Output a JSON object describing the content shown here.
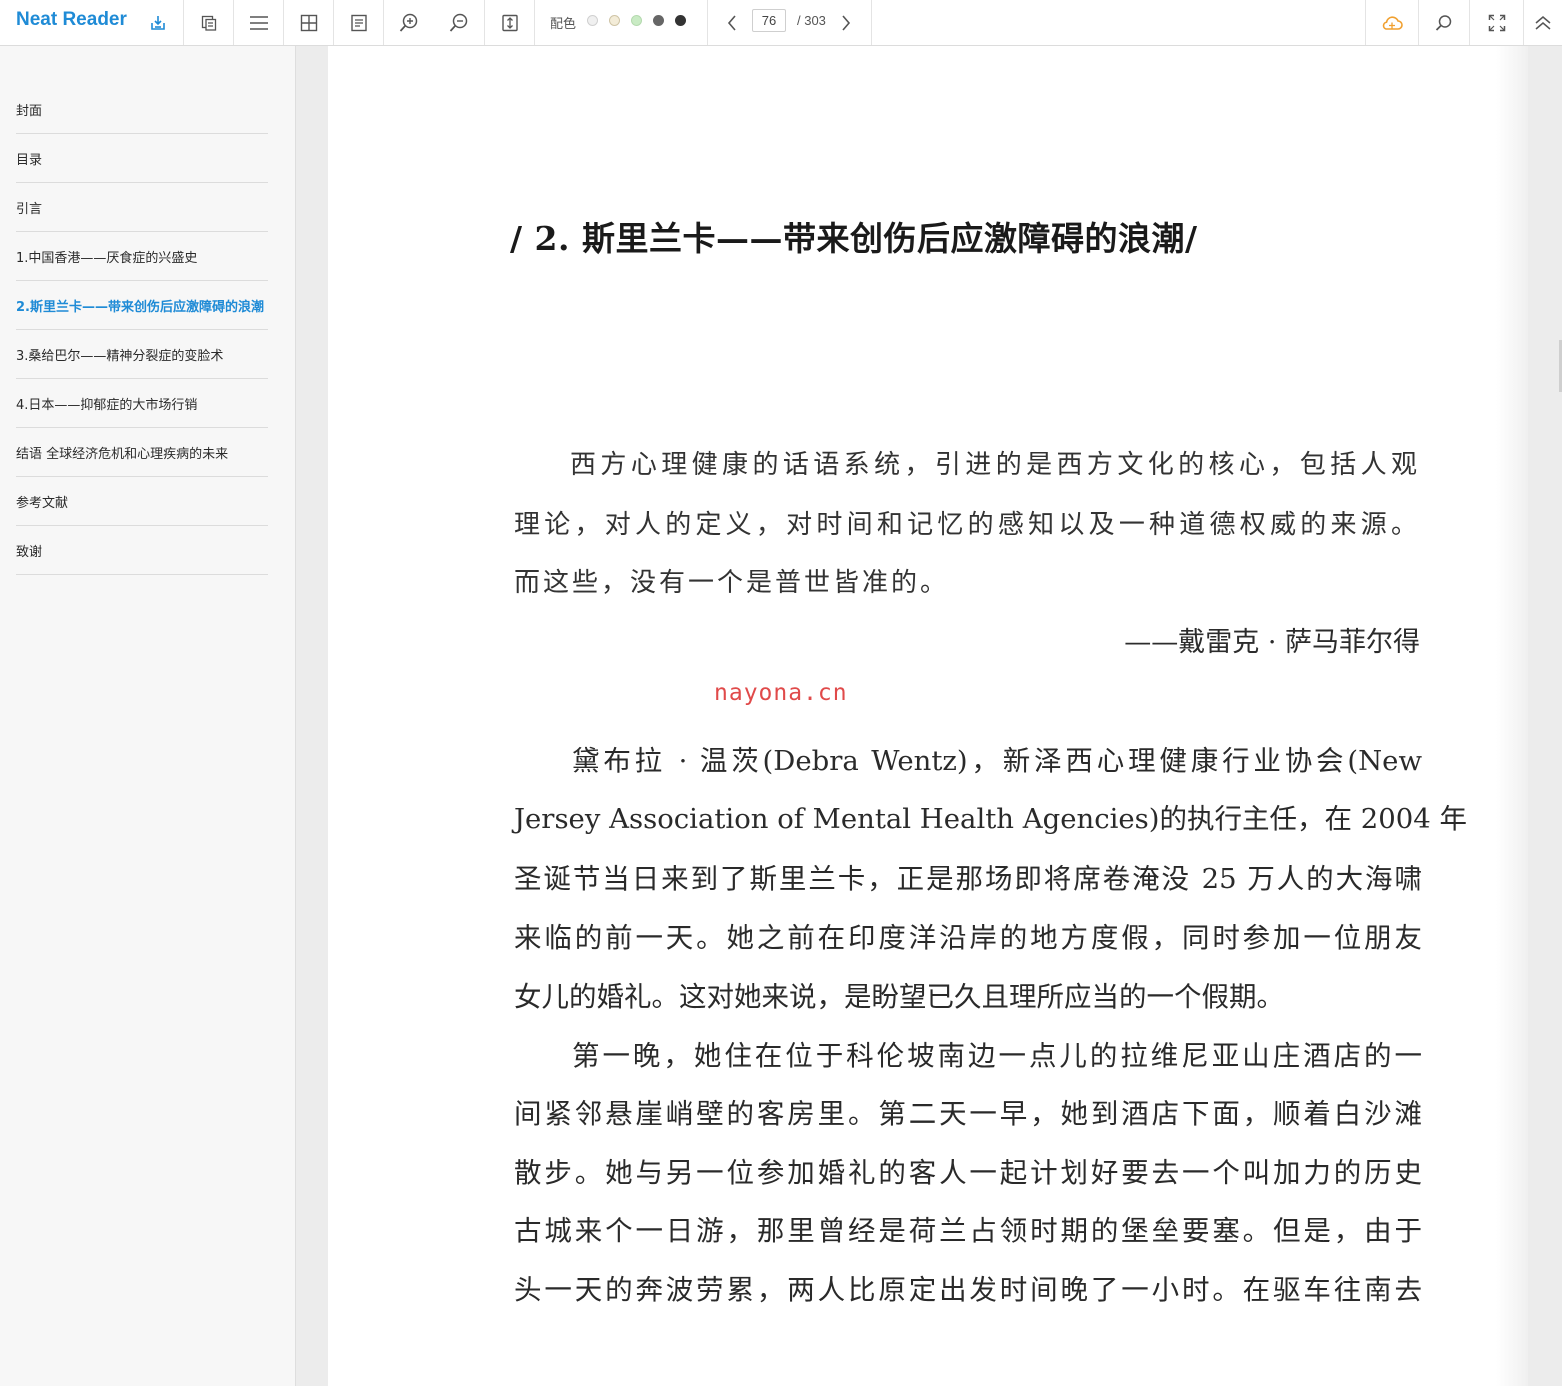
{
  "app": {
    "title": "Neat Reader"
  },
  "toolbar": {
    "palette_label": "配色",
    "palette_colors": [
      "#f0f0f0",
      "#f3ecd8",
      "#c9ebc4",
      "#666666",
      "#333333"
    ],
    "current_page": "76",
    "total_pages": "/ 303",
    "accent_color": "#1f8bd6",
    "cloud_color": "#f0a030",
    "icons": [
      "export-icon",
      "copy-pages-icon",
      "menu-icon",
      "grid-icon",
      "notes-icon",
      "zoom-in-icon",
      "zoom-out-icon",
      "fit-height-icon",
      "prev-page-icon",
      "next-page-icon",
      "cloud-sync-icon",
      "search-icon",
      "fullscreen-icon",
      "collapse-icon"
    ]
  },
  "sidebar": {
    "active_index": 4,
    "items": [
      {
        "label": "封面"
      },
      {
        "label": "目录"
      },
      {
        "label": "引言"
      },
      {
        "label": "1.中国香港——厌食症的兴盛史"
      },
      {
        "label": "2.斯里兰卡——带来创伤后应激障碍的浪潮"
      },
      {
        "label": "3.桑给巴尔——精神分裂症的变脸术"
      },
      {
        "label": "4.日本——抑郁症的大市场行销"
      },
      {
        "label": "结语 全球经济危机和心理疾病的未来"
      },
      {
        "label": "参考文献"
      },
      {
        "label": "致谢"
      }
    ]
  },
  "page": {
    "chapter_title": "/ 2. 斯里兰卡——带来创伤后应激障碍的浪潮/",
    "epigraph_lines": [
      "西方心理健康的话语系统，引进的是西方文化的核心，包括人观",
      "理论，对人的定义，对时间和记忆的感知以及一种道德权威的来源。",
      "而这些，没有一个是普世皆准的。"
    ],
    "epigraph_author": "——戴雷克 · 萨马菲尔得",
    "watermark": "nayona.cn",
    "body_lines": [
      "黛布拉 · 温茨(Debra Wentz)，新泽西心理健康行业协会(New",
      "Jersey Association of Mental Health Agencies)的执行主任，在 2004 年",
      "圣诞节当日来到了斯里兰卡，正是那场即将席卷淹没 25 万人的大海啸",
      "来临的前一天。她之前在印度洋沿岸的地方度假，同时参加一位朋友",
      "女儿的婚礼。这对她来说，是盼望已久且理所应当的一个假期。",
      "第一晚，她住在位于科伦坡南边一点儿的拉维尼亚山庄酒店的一",
      "间紧邻悬崖峭壁的客房里。第二天一早，她到酒店下面，顺着白沙滩",
      "散步。她与另一位参加婚礼的客人一起计划好要去一个叫加力的历史",
      "古城来个一日游，那里曾经是荷兰占领时期的堡垒要塞。但是，由于",
      "头一天的奔波劳累，两人比原定出发时间晚了一小时。在驱车往南去"
    ]
  }
}
